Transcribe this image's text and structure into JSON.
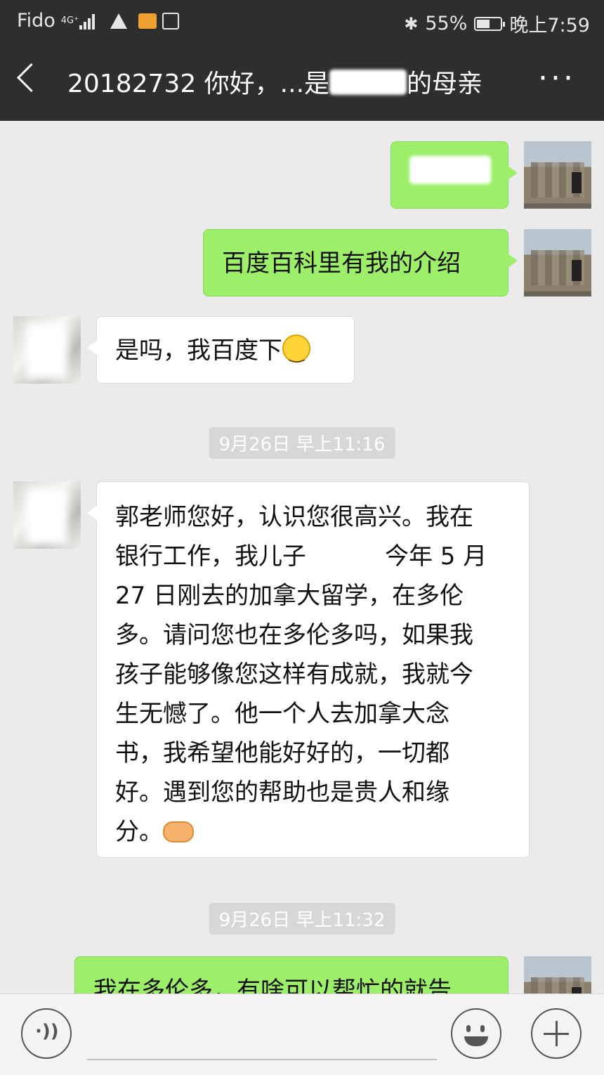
{
  "status_bar": {
    "carrier": "Fido",
    "network": "4G⁺",
    "battery": "55%",
    "battery_level": 0.55,
    "time": "晚上7:59"
  },
  "header": {
    "title_prefix": "20182732 你好，...是",
    "title_suffix": "的母亲",
    "more_icon": "···"
  },
  "messages": [
    {
      "side": "me",
      "text_redacted": "郭■■"
    },
    {
      "side": "me",
      "text": "百度百科里有我的介绍"
    },
    {
      "side": "them",
      "text": "是吗，我百度下"
    },
    {
      "type": "time",
      "text": "9月26日 早上11:16"
    },
    {
      "side": "them",
      "lines": [
        "郭老师您好，认识您很高兴。我在",
        "银行工作，我儿子",
        "今年 5 月",
        "27 日刚去的加拿大留学，在多伦",
        "多。请问您也在多伦多吗，如果我",
        "孩子能够像您这样有成就，我就今",
        "生无憾了。他一个人去加拿大念",
        "书，我希望他能好好的，一切都",
        "好。遇到您的帮助也是贵人和缘",
        "分。"
      ]
    },
    {
      "type": "time",
      "text": "9月26日 早上11:32"
    },
    {
      "side": "me",
      "text": "我在多伦多，有啥可以帮忙的就告"
    }
  ],
  "icons": {
    "back": "back-arrow-icon",
    "voice": "voice-icon",
    "emoji": "emoji-icon",
    "plus": "plus-icon"
  },
  "colors": {
    "header_bg": "#2e2e2e",
    "chat_bg": "#ebebeb",
    "my_bubble": "#9def6a",
    "their_bubble": "#ffffff"
  }
}
